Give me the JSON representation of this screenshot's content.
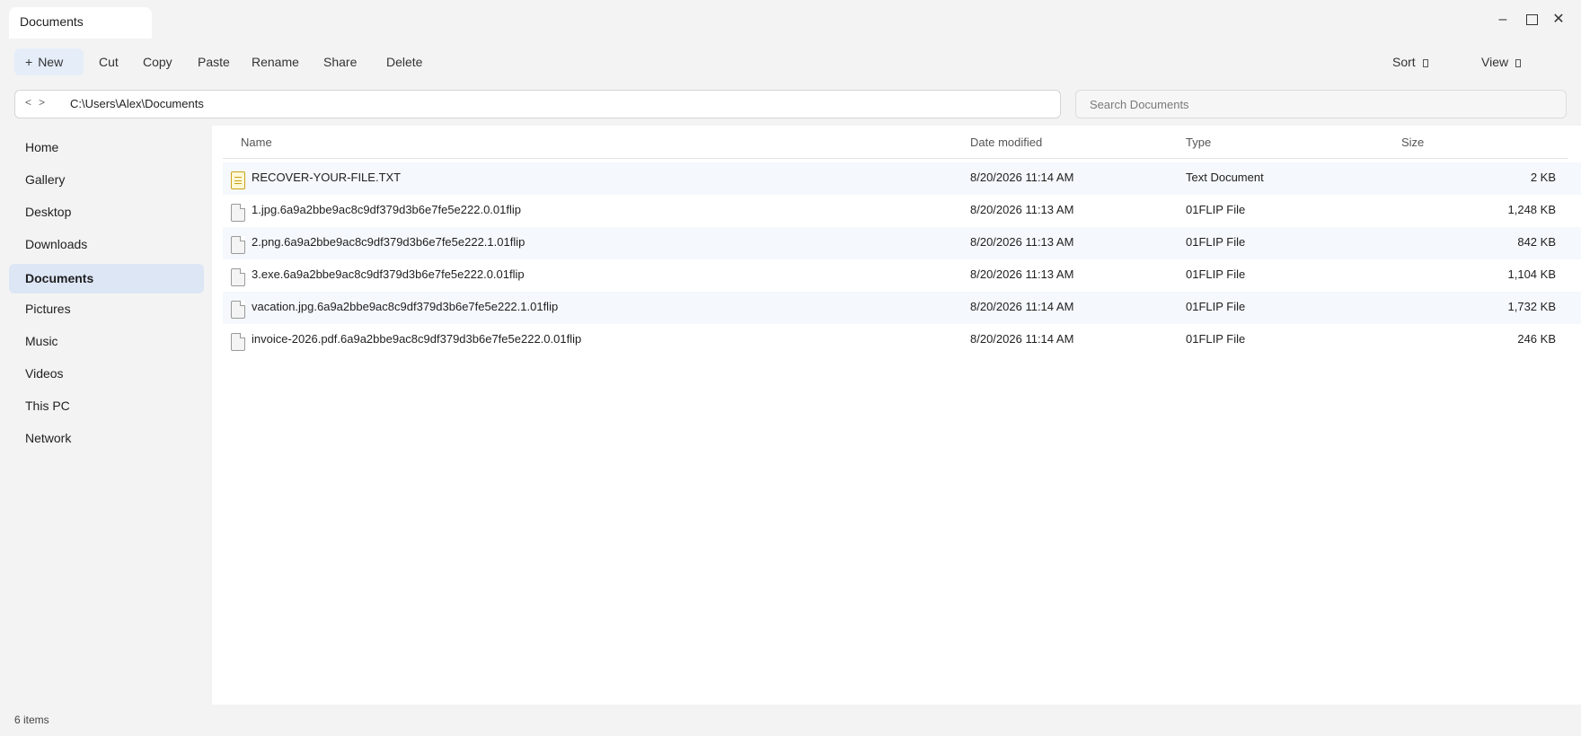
{
  "window": {
    "tab_title": "Documents"
  },
  "toolbar": {
    "new_label": "New",
    "new_icon": "plus-icon",
    "cut_label": "Cut",
    "copy_label": "Copy",
    "paste_label": "Paste",
    "rename_label": "Rename",
    "share_label": "Share",
    "delete_label": "Delete",
    "sort_label": "Sort",
    "view_label": "View"
  },
  "address": {
    "back": "<",
    "forward": ">",
    "path": "C:\\Users\\Alex\\Documents"
  },
  "search": {
    "placeholder": "Search Documents"
  },
  "sidebar": {
    "items": [
      {
        "label": "Home"
      },
      {
        "label": "Gallery"
      },
      {
        "label": "Desktop"
      },
      {
        "label": "Downloads"
      },
      {
        "label": "Documents",
        "active": true
      },
      {
        "label": "Pictures"
      },
      {
        "label": "Music"
      },
      {
        "label": "Videos"
      },
      {
        "label": "This PC"
      },
      {
        "label": "Network"
      }
    ]
  },
  "columns": {
    "name": "Name",
    "date": "Date modified",
    "type": "Type",
    "size": "Size"
  },
  "files": [
    {
      "name": "RECOVER-YOUR-FILE.TXT",
      "date": "8/20/2026 11:14 AM",
      "type": "Text Document",
      "size": "2 KB",
      "icon": "text-file-icon"
    },
    {
      "name": "1.jpg.6a9a2bbe9ac8c9df379d3b6e7fe5e222.0.01flip",
      "date": "8/20/2026 11:13 AM",
      "type": "01FLIP File",
      "size": "1,248 KB",
      "icon": "generic-file-icon"
    },
    {
      "name": "2.png.6a9a2bbe9ac8c9df379d3b6e7fe5e222.1.01flip",
      "date": "8/20/2026 11:13 AM",
      "type": "01FLIP File",
      "size": "842 KB",
      "icon": "generic-file-icon"
    },
    {
      "name": "3.exe.6a9a2bbe9ac8c9df379d3b6e7fe5e222.0.01flip",
      "date": "8/20/2026 11:13 AM",
      "type": "01FLIP File",
      "size": "1,104 KB",
      "icon": "generic-file-icon"
    },
    {
      "name": "vacation.jpg.6a9a2bbe9ac8c9df379d3b6e7fe5e222.1.01flip",
      "date": "8/20/2026 11:14 AM",
      "type": "01FLIP File",
      "size": "1,732 KB",
      "icon": "generic-file-icon"
    },
    {
      "name": "invoice-2026.pdf.6a9a2bbe9ac8c9df379d3b6e7fe5e222.0.01flip",
      "date": "8/20/2026 11:14 AM",
      "type": "01FLIP File",
      "size": "246 KB",
      "icon": "generic-file-icon"
    }
  ],
  "status": {
    "item_count": "6 items"
  }
}
